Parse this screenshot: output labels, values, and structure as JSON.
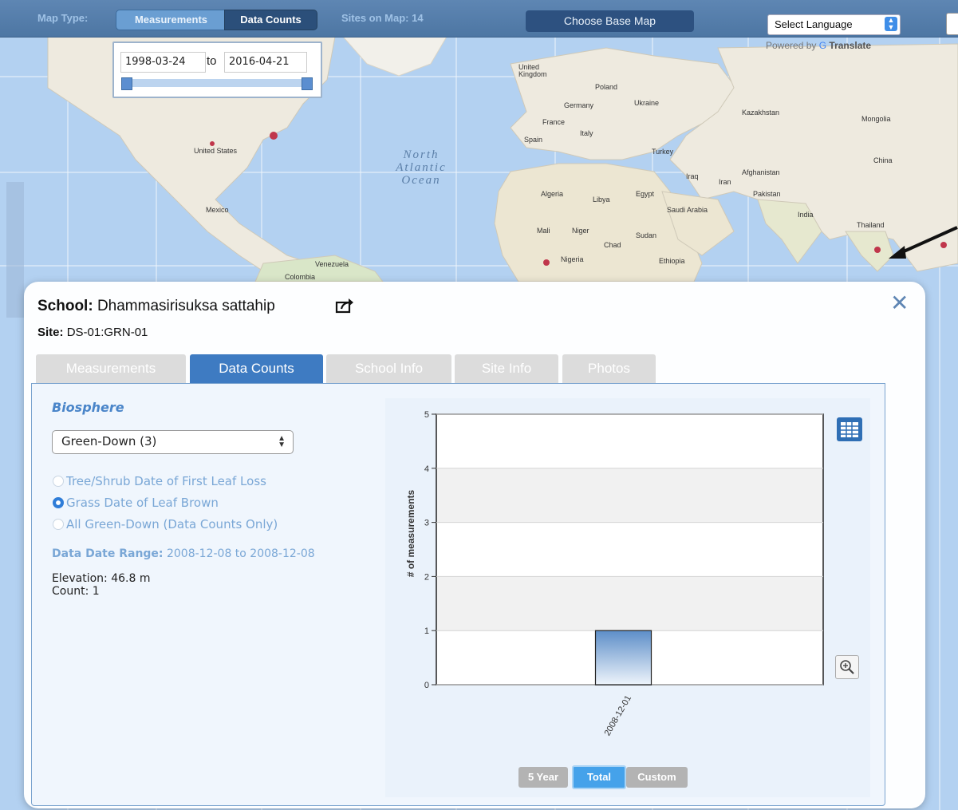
{
  "toolbar": {
    "map_type_label": "Map Type:",
    "measurements_label": "Measurements",
    "data_counts_label": "Data Counts",
    "sites_label": "Sites on Map: 14",
    "base_map_label": "Choose Base Map",
    "language_label": "Select Language",
    "powered_by": "Powered by",
    "translate": "Translate"
  },
  "date_filter": {
    "from": "1998-03-24",
    "to_word": "to",
    "to": "2016-04-21"
  },
  "map_labels": {
    "united_states": "United States",
    "mexico": "Mexico",
    "venezuela": "Venezuela",
    "colombia": "Colombia",
    "united_kingdom": "United Kingdom",
    "poland": "Poland",
    "germany": "Germany",
    "ukraine": "Ukraine",
    "france": "France",
    "italy": "Italy",
    "spain": "Spain",
    "turkey": "Turkey",
    "iraq": "Iraq",
    "iran": "Iran",
    "algeria": "Algeria",
    "libya": "Libya",
    "egypt": "Egypt",
    "saudi_arabia": "Saudi Arabia",
    "mali": "Mali",
    "niger": "Niger",
    "chad": "Chad",
    "sudan": "Sudan",
    "nigeria": "Nigeria",
    "ethiopia": "Ethiopia",
    "kazakhstan": "Kazakhstan",
    "mongolia": "Mongolia",
    "china": "China",
    "afghanistan": "Afghanistan",
    "pakistan": "Pakistan",
    "india": "India",
    "thailand": "Thailand",
    "ocean": "North Atlantic Ocean",
    "ocean_line1": "North",
    "ocean_line2": "Atlantic",
    "ocean_line3": "Ocean"
  },
  "modal": {
    "school_label": "School:",
    "school_name": "Dhammasirisuksa sattahip",
    "site_label": "Site:",
    "site_id": "DS-01:GRN-01",
    "tabs": [
      {
        "label": "Measurements"
      },
      {
        "label": "Data Counts"
      },
      {
        "label": "School Info"
      },
      {
        "label": "Site Info"
      },
      {
        "label": "Photos"
      }
    ],
    "active_tab": "Data Counts",
    "section_title": "Biosphere",
    "variable_select": "Green-Down (3)",
    "radios": [
      {
        "label": "Tree/Shrub Date of First Leaf Loss",
        "checked": false
      },
      {
        "label": "Grass Date of Leaf Brown",
        "checked": true
      },
      {
        "label": "All Green-Down (Data Counts Only)",
        "checked": false
      }
    ],
    "date_range_label": "Data Date Range:",
    "date_range_value": "2008-12-08 to 2008-12-08",
    "elevation": "Elevation: 46.8 m",
    "count": "Count: 1",
    "range_buttons": {
      "five_year": "5 Year",
      "total": "Total",
      "custom": "Custom"
    }
  },
  "colors": {
    "accent": "#3e7bc2",
    "toolbar": "#4d76a3",
    "link_blue": "#7aa7d6"
  },
  "chart_data": {
    "type": "bar",
    "categories": [
      "2008-12-01"
    ],
    "values": [
      1
    ],
    "ylabel": "# of measurements",
    "xlabel": "",
    "ylim": [
      0,
      5
    ],
    "yticks": [
      0,
      1,
      2,
      3,
      4,
      5
    ],
    "grid": true
  }
}
